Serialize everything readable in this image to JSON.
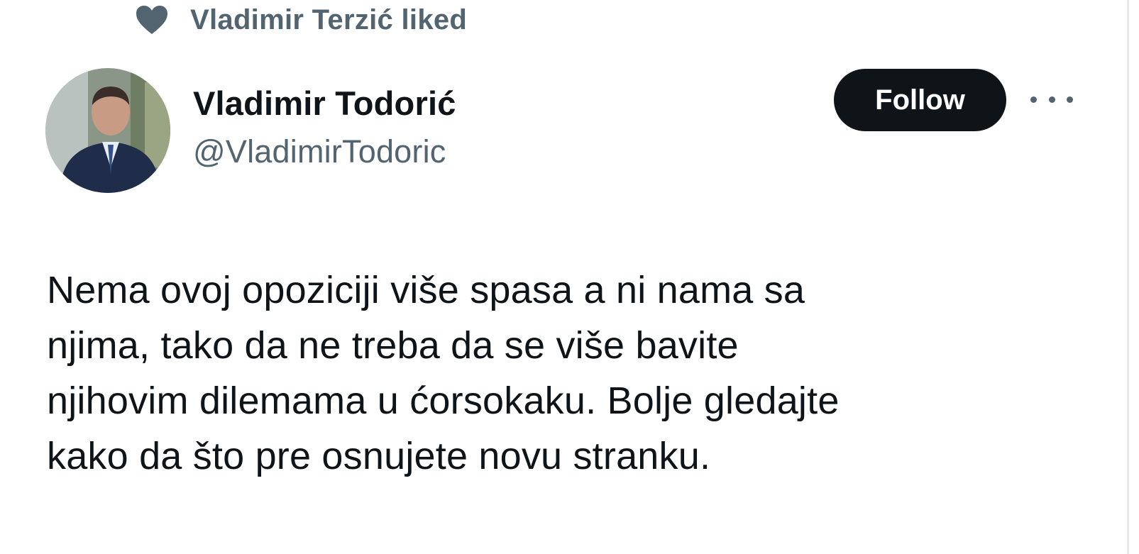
{
  "social_context": {
    "icon": "heart-icon",
    "text": "Vladimir Terzić liked"
  },
  "author": {
    "display_name": "Vladimir Todorić",
    "handle": "@VladimirTodoric",
    "avatar": "avatar-photo"
  },
  "actions": {
    "follow_label": "Follow",
    "more_icon": "more-icon"
  },
  "tweet": {
    "lines": [
      "Nema ovoj opoziciji više spasa a ni nama sa",
      "njima, tako da ne treba da se više bavite",
      "njihovim dilemama u ćorsokaku. Bolje gledajte",
      "kako da što pre osnujete novu stranku."
    ]
  },
  "colors": {
    "primary_text": "#0f1419",
    "secondary_text": "#536471",
    "follow_bg": "#0f1419",
    "follow_text": "#ffffff"
  }
}
